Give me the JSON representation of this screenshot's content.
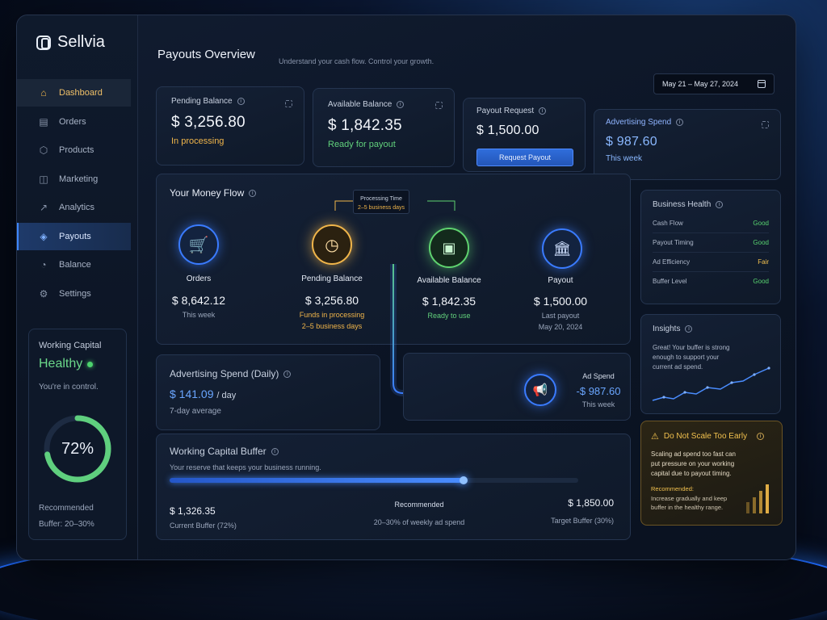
{
  "app": {
    "name": "Sellvia"
  },
  "nav": {
    "items": [
      {
        "label": "Dashboard",
        "icon": "home-icon"
      },
      {
        "label": "Orders",
        "icon": "clipboard-icon"
      },
      {
        "label": "Products",
        "icon": "box-icon"
      },
      {
        "label": "Marketing",
        "icon": "bag-icon"
      },
      {
        "label": "Analytics",
        "icon": "chart-icon"
      },
      {
        "label": "Payouts",
        "icon": "layers-icon"
      },
      {
        "label": "Balance",
        "icon": "pie-icon"
      },
      {
        "label": "Settings",
        "icon": "gear-icon"
      }
    ]
  },
  "working_capital": {
    "title": "Working Capital",
    "status": "Healthy",
    "subtitle": "You're in control.",
    "percent": "72%",
    "percent_value": 0.72,
    "recommended_label": "Recommended",
    "buffer_text": "Buffer: 20–30%"
  },
  "header": {
    "title": "Payouts Overview",
    "subtitle": "Understand your cash flow. Control your growth.",
    "date_range": "May 21 – May 27, 2024"
  },
  "kpis": {
    "pending": {
      "label": "Pending Balance",
      "value": "$ 3,256.80",
      "sub": "In processing"
    },
    "available": {
      "label": "Available Balance",
      "value": "$  1,842.35",
      "sub": "Ready for payout"
    },
    "payout_request": {
      "label": "Payout Request",
      "value": "$ 1,500.00",
      "button": "Request Payout"
    },
    "ad_spend": {
      "label": "Advertising Spend",
      "value": "$ 987.60",
      "sub": "This week"
    }
  },
  "money_flow": {
    "title": "Your Money Flow",
    "processing": {
      "label": "Processing Time",
      "value": "2–5 business days"
    },
    "nodes": [
      {
        "label": "Orders",
        "value": "$ 8,642.12",
        "sub": "This week",
        "sub2": ""
      },
      {
        "label": "Pending Balance",
        "value": "$ 3,256.80",
        "sub": "Funds in processing",
        "sub2": "2–5 business days"
      },
      {
        "label": "Available Balance",
        "value": "$ 1,842.35",
        "sub": "Ready to use",
        "sub2": ""
      },
      {
        "label": "Payout",
        "value": "$ 1,500.00",
        "sub": "Last payout",
        "sub2": "May 20, 2024"
      }
    ]
  },
  "ad_daily": {
    "title": "Advertising Spend (Daily)",
    "value": "$ 141.09",
    "unit": "/ day",
    "sub": "7-day average"
  },
  "ad_spend_node": {
    "label": "Ad Spend",
    "value": "-$ 987.60",
    "sub": "This week"
  },
  "buffer": {
    "title": "Working Capital Buffer",
    "subtitle": "Your reserve that keeps your business running.",
    "fill": 0.72,
    "current_value": "$ 1,326.35",
    "current_label": "Current Buffer (72%)",
    "recommended_title": "Recommended",
    "recommended_sub": "20–30% of weekly ad spend",
    "target_value": "$ 1,850.00",
    "target_label": "Target Buffer (30%)"
  },
  "business_health": {
    "title": "Business Health",
    "rows": [
      {
        "label": "Cash Flow",
        "status": "Good",
        "color": "#58d36f"
      },
      {
        "label": "Payout Timing",
        "status": "Good",
        "color": "#58d36f"
      },
      {
        "label": "Ad Efficiency",
        "status": "Fair",
        "color": "#f2c14e"
      },
      {
        "label": "Buffer Level",
        "status": "Good",
        "color": "#58d36f"
      }
    ]
  },
  "insights": {
    "title": "Insights",
    "text": "Great! Your buffer is strong enough to support your current ad spend."
  },
  "warning": {
    "title": "Do Not Scale Too Early",
    "text": "Scaling ad spend too fast can put pressure on your working capital due to payout timing.",
    "rec_label": "Recommended:",
    "rec_text": "Increase gradually and keep buffer in the healthy range."
  },
  "colors": {
    "accent": "#3e86ff",
    "good": "#58d36f",
    "warn": "#f2c14e",
    "pending": "#f0b54a"
  }
}
